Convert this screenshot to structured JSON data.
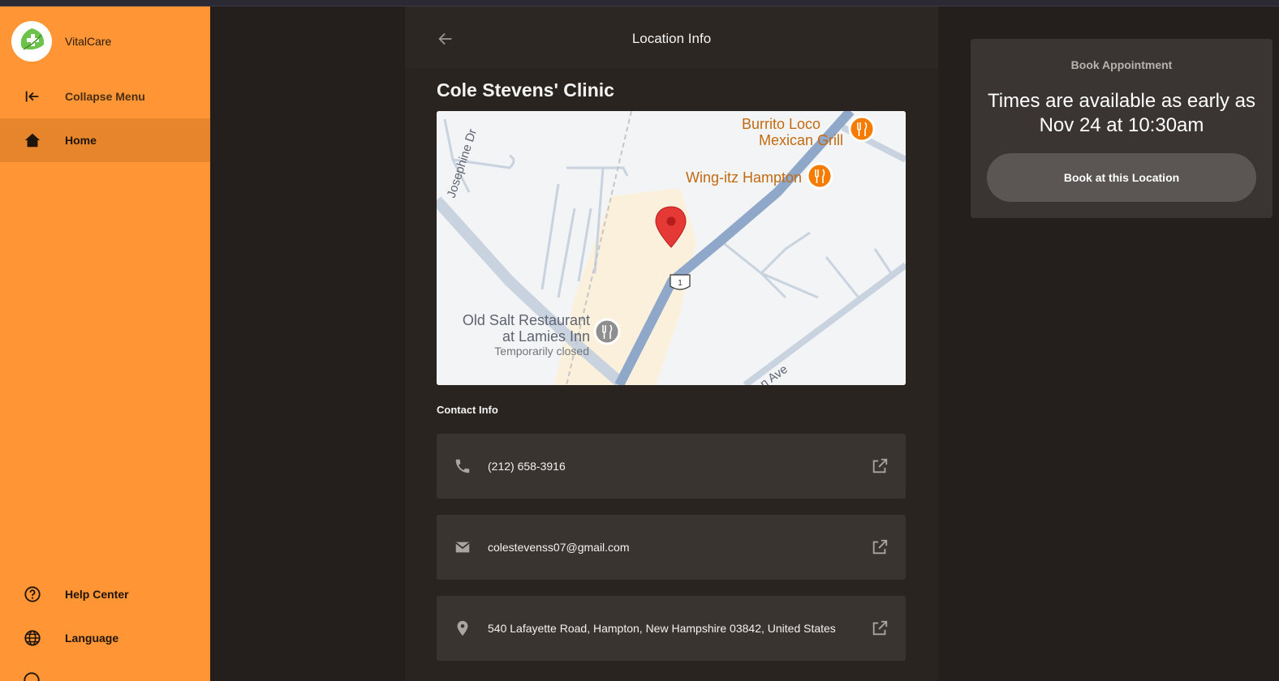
{
  "app": {
    "name": "VitalCare"
  },
  "sidebar": {
    "collapse_label": "Collapse Menu",
    "items": [
      {
        "label": "Home",
        "icon": "home-icon",
        "active": true
      }
    ],
    "bottom_items": [
      {
        "label": "Help Center",
        "icon": "help-circle-icon"
      },
      {
        "label": "Language",
        "icon": "globe-icon"
      }
    ]
  },
  "header": {
    "title": "Location Info",
    "back_icon": "arrow-left-icon"
  },
  "clinic": {
    "name": "Cole Stevens' Clinic"
  },
  "map": {
    "labels": {
      "burrito_1": "Burrito Loco",
      "burrito_2": "Mexican Grill",
      "wingitz": "Wing-itz Hampton",
      "oldsalt_1": "Old Salt Restaurant",
      "oldsalt_2": "at Lamies Inn",
      "oldsalt_status": "Temporarily closed",
      "street_josephine": "Josephine Dr",
      "street_ave": "n Ave",
      "route": "1"
    }
  },
  "contact": {
    "title": "Contact Info",
    "phone": "(212) 658-3916",
    "email": "colestevenss07@gmail.com",
    "address": "540 Lafayette Road, Hampton, New Hampshire 03842, United States"
  },
  "booking": {
    "title": "Book Appointment",
    "times": "Times are available as early as Nov 24 at 10:30am",
    "button_label": "Book at this Location"
  },
  "colors": {
    "sidebar": "#ff9535",
    "sidebar_active": "#e6852c",
    "background": "#241f1c",
    "card": "#3a3431",
    "map_pin": "#e53935",
    "restaurant_marker": "#f57c00"
  }
}
